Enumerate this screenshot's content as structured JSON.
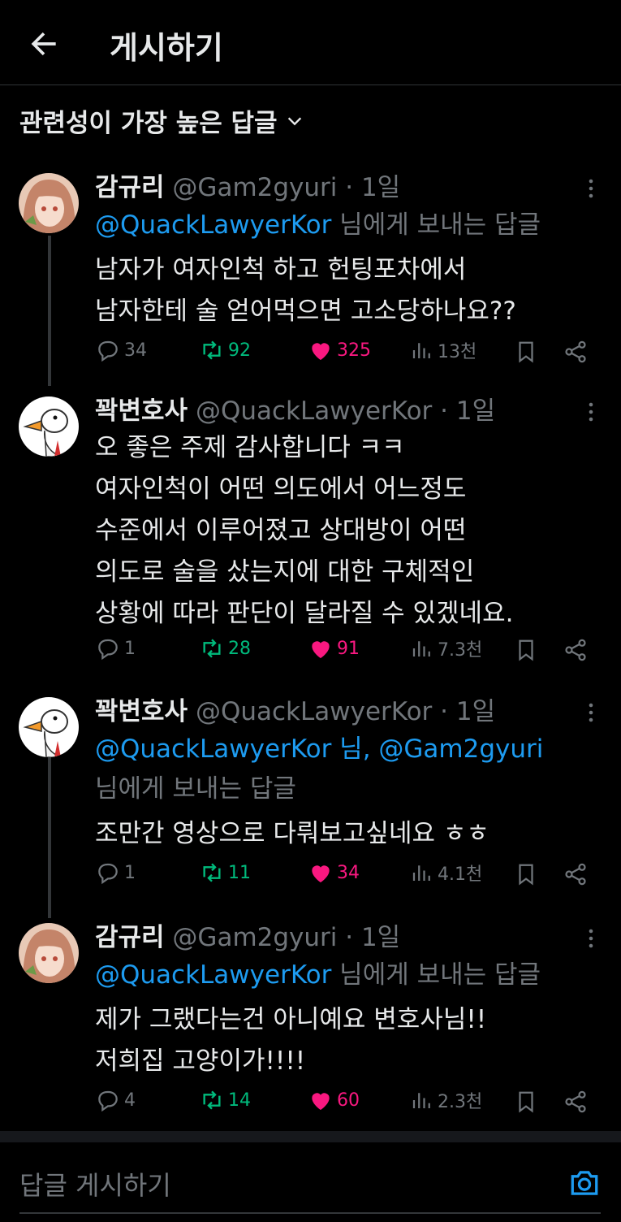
{
  "header": {
    "title": "게시하기"
  },
  "sort": {
    "label": "관련성이 가장 높은 답글"
  },
  "tweets": [
    {
      "name": "감규리",
      "handle": "@Gam2gyuri",
      "sep": " · ",
      "time": "1일",
      "reply_to": "@QuackLawyerKor",
      "reply_suffix": " 님에게 보내는 답글",
      "lines": [
        "남자가 여자인척 하고 헌팅포차에서",
        "남자한테 술 얻어먹으면 고소당하나요??"
      ],
      "replies": "34",
      "retweets": "92",
      "likes": "325",
      "views": "13천"
    },
    {
      "name": "꽉변호사",
      "handle": "@QuackLawyerKor",
      "sep": " · ",
      "time": "1일",
      "lines": [
        "오 좋은 주제 감사합니다 ㅋㅋ",
        "여자인척이 어떤 의도에서 어느정도",
        "수준에서 이루어졌고 상대방이 어떤",
        "의도로 술을 샀는지에 대한 구체적인",
        "상황에 따라 판단이 달라질 수 있겠네요."
      ],
      "replies": "1",
      "retweets": "28",
      "likes": "91",
      "views": "7.3천"
    },
    {
      "name": "꽉변호사",
      "handle": "@QuackLawyerKor",
      "sep": " · ",
      "time": "1일",
      "reply_to": "@QuackLawyerKor 님, @Gam2gyuri",
      "reply_suffix": "님에게 보내는 답글",
      "lines": [
        "조만간 영상으로 다뤄보고싶네요 ㅎㅎ"
      ],
      "replies": "1",
      "retweets": "11",
      "likes": "34",
      "views": "4.1천"
    },
    {
      "name": "감규리",
      "handle": "@Gam2gyuri",
      "sep": " · ",
      "time": "1일",
      "reply_to": "@QuackLawyerKor",
      "reply_suffix": " 님에게 보내는 답글",
      "lines": [
        "제가 그랬다는건 아니예요 변호사님!!",
        "저희집 고양이가!!!!"
      ],
      "replies": "4",
      "retweets": "14",
      "likes": "60",
      "views": "2.3천"
    }
  ],
  "compose": {
    "placeholder": "답글 게시하기"
  }
}
